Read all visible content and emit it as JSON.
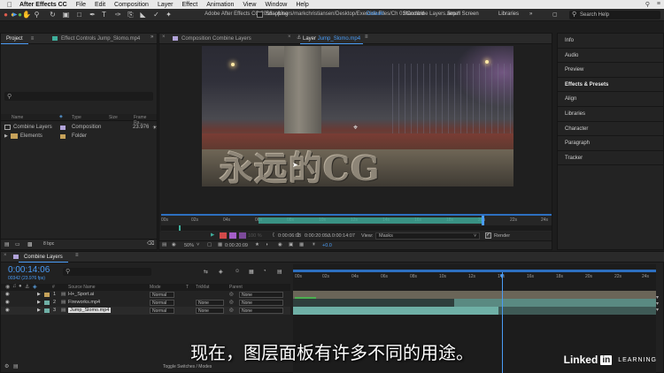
{
  "macos_menu": {
    "app": "After Effects CC",
    "items": [
      "File",
      "Edit",
      "Composition",
      "Layer",
      "Effect",
      "Animation",
      "View",
      "Window",
      "Help"
    ]
  },
  "toolbar": {
    "window_title": "Adobe After Effects CC 2018 - /Users/markchristiansen/Desktop/Exercise Files/Ch 01/Combine Layers.aep *",
    "snapping_label": "Snapping",
    "workspaces": [
      "Default",
      "Standard",
      "Small Screen",
      "Libraries"
    ],
    "search_placeholder": "Search Help"
  },
  "project_panel": {
    "tab_project": "Project",
    "tab_effect_controls": "Effect Controls Jump_Slomo.mp4",
    "columns": [
      "Name",
      "Type",
      "Size",
      "Frame Ra..."
    ],
    "items": [
      {
        "name": "Combine Layers",
        "type": "Composition",
        "frame_rate": "23.976"
      },
      {
        "name": "Elements",
        "type": "Folder",
        "frame_rate": ""
      }
    ],
    "bit_depth": "8 bpc"
  },
  "viewer": {
    "tab_composition": "Composition Combine Layers",
    "tab_layer_prefix": "Layer",
    "tab_layer_name": "Jump_Slomo.mp4",
    "watermark": "永远的CG",
    "ruler_labels": [
      "00s",
      "02s",
      "04s",
      "06s",
      "08s",
      "10s",
      "12s",
      "14s",
      "16s",
      "18s",
      "20s",
      "22s",
      "24s"
    ],
    "zoom": "50%",
    "timecode": "0:00:20:09",
    "in_point": "0:00:06:03",
    "out_point": "0:00:20:09",
    "duration": "Δ 0:00:14:07",
    "view_label": "View:",
    "view_value": "Masks",
    "render_label": "Render",
    "exposure": "+0.0",
    "opacity": "100 %"
  },
  "right_panel": {
    "items": [
      "Info",
      "Audio",
      "Preview",
      "Effects & Presets",
      "Align",
      "Libraries",
      "Character",
      "Paragraph",
      "Tracker"
    ]
  },
  "timeline": {
    "tab": "Combine Layers",
    "timecode": "0:00:14:06",
    "frame_info": "00342 (23.976 fps)",
    "headers": {
      "index": "#",
      "source": "Source Name",
      "mode": "Mode",
      "t": "T",
      "trkmat": "TrkMat",
      "parent": "Parent"
    },
    "layers": [
      {
        "index": "1",
        "name": "H+_Sport.ai",
        "mode": "Normal",
        "trkmat": "",
        "parent": "None"
      },
      {
        "index": "2",
        "name": "Fireworks.mp4",
        "mode": "Normal",
        "trkmat": "None",
        "parent": "None"
      },
      {
        "index": "3",
        "name": "Jump_Slomo.mp4",
        "mode": "Normal",
        "trkmat": "None",
        "parent": "None"
      }
    ],
    "ruler_labels": [
      "00s",
      "02s",
      "04s",
      "06s",
      "08s",
      "10s",
      "12s",
      "14s",
      "16s",
      "18s",
      "20s",
      "22s",
      "24s"
    ],
    "toggle_label": "Toggle Switches / Modes"
  },
  "subtitle": "现在，图层面板有许多不同的用途。",
  "branding": {
    "linked": "Linked",
    "in": "in",
    "learning": "LEARNING"
  },
  "colors": {
    "accent": "#4a9cf6",
    "teal": "#3fae9c",
    "layer_label": "#6fb0a6",
    "purple": "#a45ec8",
    "red": "#d24a4a"
  }
}
